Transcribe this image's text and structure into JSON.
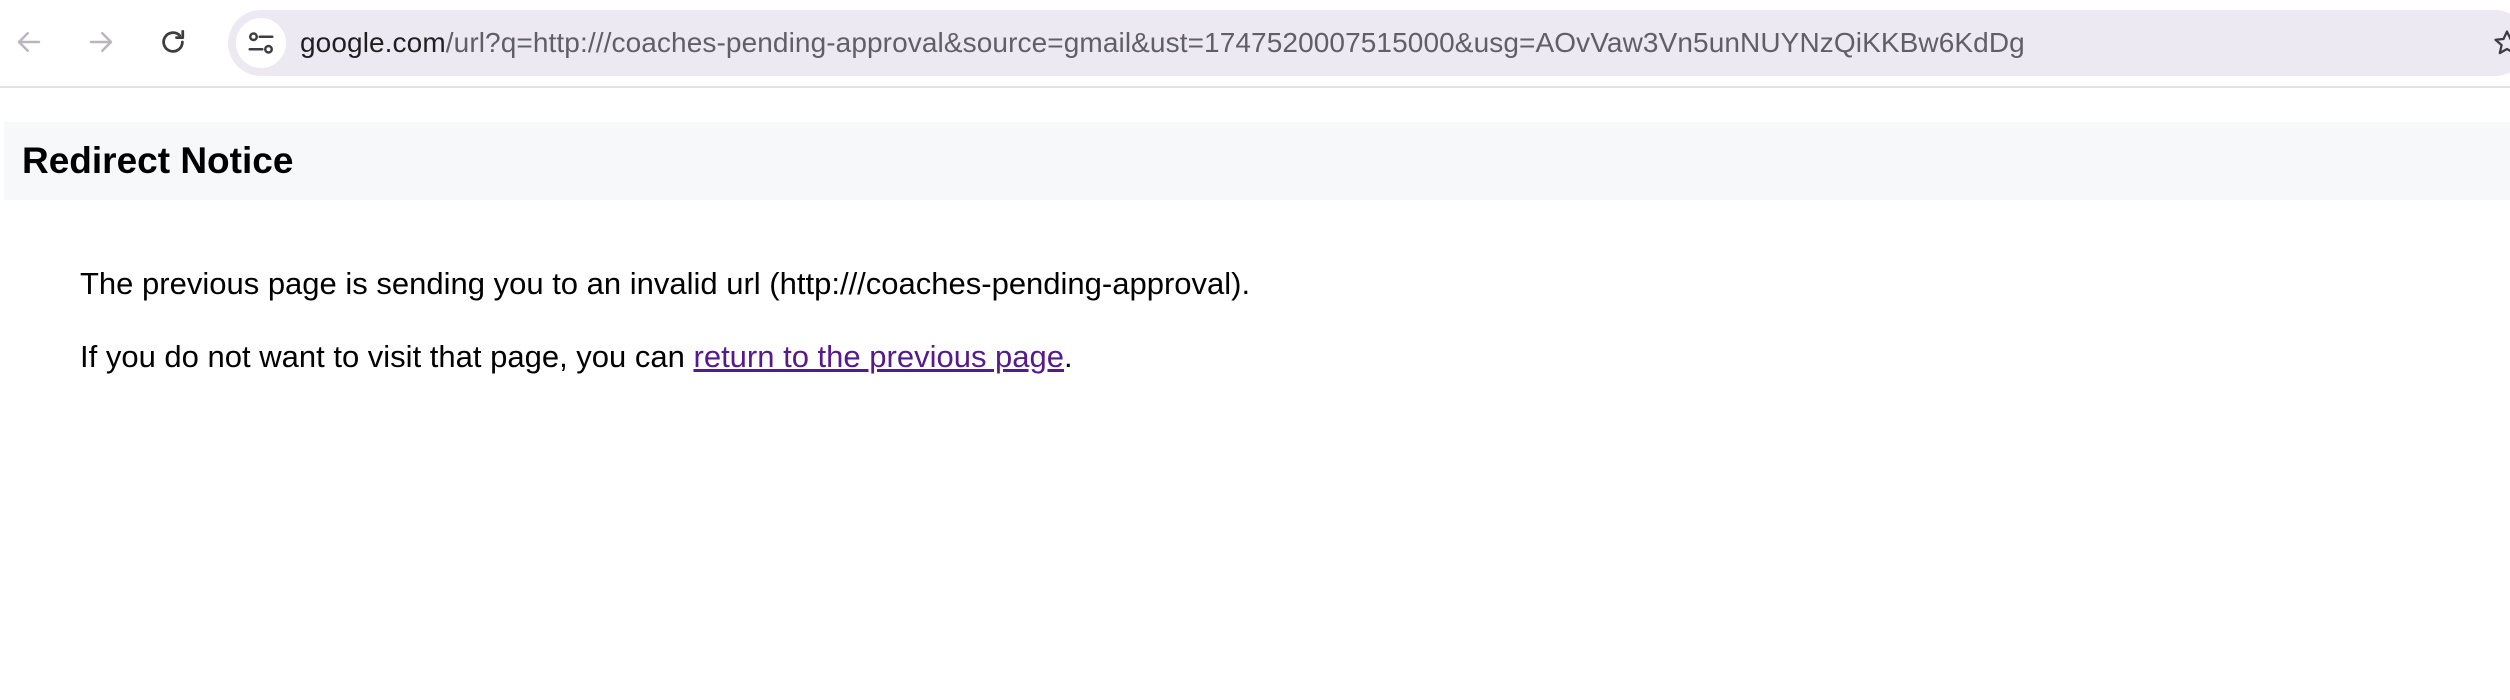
{
  "browser": {
    "back_icon": "arrow-left-icon",
    "forward_icon": "arrow-right-icon",
    "reload_icon": "reload-icon",
    "site_info_icon": "tune-icon",
    "bookmark_icon": "star-icon",
    "url": {
      "host": "google.com",
      "rest": "/url?q=http:///coaches-pending-approval&source=gmail&ust=1747520007515000&usg=AOvVaw3Vn5unNUYNzQiKKBw6KdDg"
    }
  },
  "page": {
    "title": "Redirect Notice",
    "message": "The previous page is sending you to an invalid url (http:///coaches-pending-approval).",
    "prompt_before": "If you do not want to visit that page, you can ",
    "back_link": "return to the previous page",
    "prompt_after": "."
  },
  "colors": {
    "link": "#551a8b",
    "omnibox_bg": "#ede9f3",
    "notice_bg": "#f7f8fa"
  }
}
